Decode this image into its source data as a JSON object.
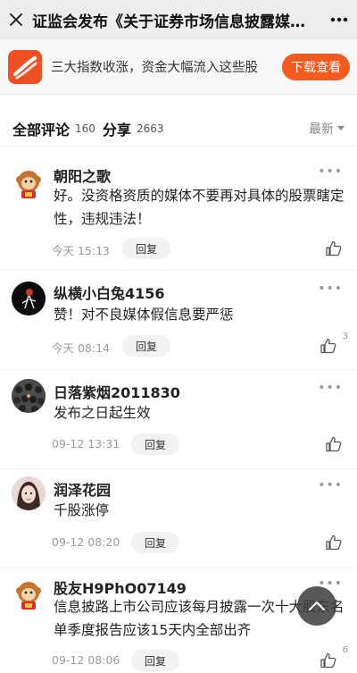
{
  "nav": {
    "title": "证监会发布《关于证券市场信息披露媒体…",
    "close_icon": "close-icon",
    "more_icon": "more-horizontal-icon"
  },
  "banner": {
    "text": "三大指数收涨，资金大幅流入这些股",
    "button": "下载查看",
    "accent": "#f25a1e"
  },
  "comments_header": {
    "all_label": "全部评论",
    "all_count": "160",
    "share_label": "分享",
    "share_count": "2663",
    "sort_label": "最新"
  },
  "comments": [
    {
      "name": "朝阳之歌",
      "text": "好。没资格资质的媒体不要再对具体的股票瞎定性，违规违法！",
      "time": "今天 15:13",
      "reply": "回复",
      "likes": ""
    },
    {
      "name": "纵横小白兔4156",
      "text": "赞！对不良媒体假信息要严惩",
      "time": "今天 08:14",
      "reply": "回复",
      "likes": "3"
    },
    {
      "name": "日落紫烟2011830",
      "text": "发布之日起生效",
      "time": "09-12 13:31",
      "reply": "回复",
      "likes": ""
    },
    {
      "name": "润泽花园",
      "text": "千股涨停",
      "time": "09-12 08:20",
      "reply": "回复",
      "likes": ""
    },
    {
      "name": "股友H9PhO07149",
      "text": "信息披路上市公司应该每月披露一次十大股东名单季度报告应该15天内全部出齐",
      "time": "09-12 08:06",
      "reply": "回复",
      "likes": "6"
    }
  ]
}
